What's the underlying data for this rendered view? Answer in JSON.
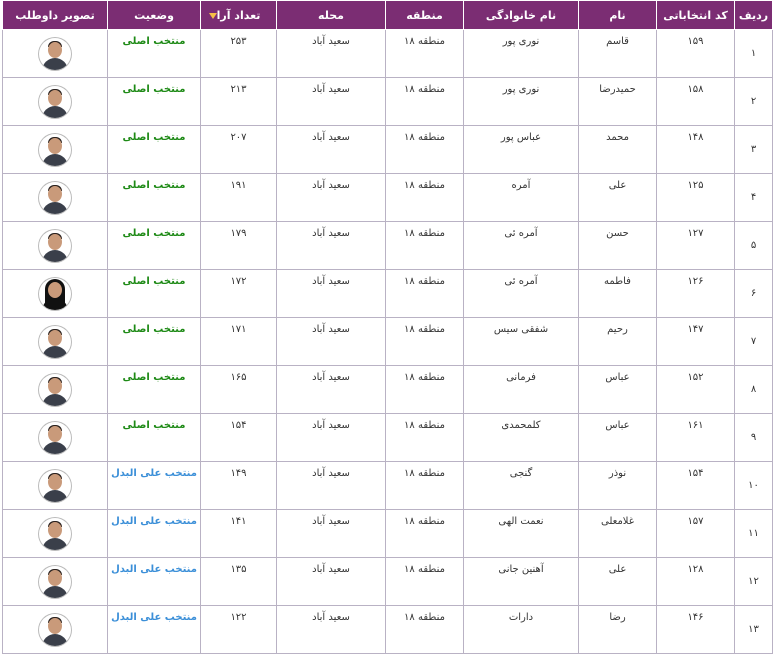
{
  "headers": {
    "row": "ردیف",
    "code": "کد انتخاباتی",
    "first_name": "نام",
    "last_name": "نام خانوادگی",
    "region": "منطقه",
    "area": "محله",
    "votes": "تعداد آرا",
    "status": "وضعیت",
    "photo": "تصویر داوطلب"
  },
  "sort_indicator_icon": "sort-desc-arrow-icon",
  "colors": {
    "header_bg": "#7b2d73",
    "status_main": "#1e8a16",
    "status_alternate": "#3b8fd8"
  },
  "rows": [
    {
      "row": "۱",
      "code": "۱۵۹",
      "first_name": "قاسم",
      "last_name": "نوری پور",
      "region": "منطقه ۱۸",
      "area": "سعید آباد",
      "votes": "۲۵۳",
      "status": "منتخب اصلی",
      "status_type": "main",
      "photo": "candidate-photo"
    },
    {
      "row": "۲",
      "code": "۱۵۸",
      "first_name": "حمیدرضا",
      "last_name": "نوری پور",
      "region": "منطقه ۱۸",
      "area": "سعید آباد",
      "votes": "۲۱۳",
      "status": "منتخب اصلی",
      "status_type": "main",
      "photo": "candidate-photo"
    },
    {
      "row": "۳",
      "code": "۱۴۸",
      "first_name": "محمد",
      "last_name": "عباس پور",
      "region": "منطقه ۱۸",
      "area": "سعید آباد",
      "votes": "۲۰۷",
      "status": "منتخب اصلی",
      "status_type": "main",
      "photo": "candidate-photo"
    },
    {
      "row": "۴",
      "code": "۱۲۵",
      "first_name": "علی",
      "last_name": "آمره",
      "region": "منطقه ۱۸",
      "area": "سعید آباد",
      "votes": "۱۹۱",
      "status": "منتخب اصلی",
      "status_type": "main",
      "photo": "candidate-photo"
    },
    {
      "row": "۵",
      "code": "۱۲۷",
      "first_name": "حسن",
      "last_name": "آمره ئی",
      "region": "منطقه ۱۸",
      "area": "سعید آباد",
      "votes": "۱۷۹",
      "status": "منتخب اصلی",
      "status_type": "main",
      "photo": "candidate-photo"
    },
    {
      "row": "۶",
      "code": "۱۲۶",
      "first_name": "فاطمه",
      "last_name": "آمره ئی",
      "region": "منطقه ۱۸",
      "area": "سعید آباد",
      "votes": "۱۷۲",
      "status": "منتخب اصلی",
      "status_type": "main",
      "photo": "candidate-photo-female"
    },
    {
      "row": "۷",
      "code": "۱۴۷",
      "first_name": "رحیم",
      "last_name": "شفقی سیس",
      "region": "منطقه ۱۸",
      "area": "سعید آباد",
      "votes": "۱۷۱",
      "status": "منتخب اصلی",
      "status_type": "main",
      "photo": "candidate-photo"
    },
    {
      "row": "۸",
      "code": "۱۵۲",
      "first_name": "عباس",
      "last_name": "فرمانی",
      "region": "منطقه ۱۸",
      "area": "سعید آباد",
      "votes": "۱۶۵",
      "status": "منتخب اصلی",
      "status_type": "main",
      "photo": "candidate-photo"
    },
    {
      "row": "۹",
      "code": "۱۶۱",
      "first_name": "عباس",
      "last_name": "کلمحمدی",
      "region": "منطقه ۱۸",
      "area": "سعید آباد",
      "votes": "۱۵۴",
      "status": "منتخب اصلی",
      "status_type": "main",
      "photo": "candidate-photo"
    },
    {
      "row": "۱۰",
      "code": "۱۵۴",
      "first_name": "نوذر",
      "last_name": "گنجی",
      "region": "منطقه ۱۸",
      "area": "سعید آباد",
      "votes": "۱۴۹",
      "status": "منتخب علی البدل",
      "status_type": "alt",
      "photo": "candidate-photo"
    },
    {
      "row": "۱۱",
      "code": "۱۵۷",
      "first_name": "غلامعلی",
      "last_name": "نعمت الهی",
      "region": "منطقه ۱۸",
      "area": "سعید آباد",
      "votes": "۱۴۱",
      "status": "منتخب علی البدل",
      "status_type": "alt",
      "photo": "candidate-photo"
    },
    {
      "row": "۱۲",
      "code": "۱۲۸",
      "first_name": "علی",
      "last_name": "آهنین جانی",
      "region": "منطقه ۱۸",
      "area": "سعید آباد",
      "votes": "۱۳۵",
      "status": "منتخب علی البدل",
      "status_type": "alt",
      "photo": "candidate-photo"
    },
    {
      "row": "۱۳",
      "code": "۱۴۶",
      "first_name": "رضا",
      "last_name": "دارات",
      "region": "منطقه ۱۸",
      "area": "سعید آباد",
      "votes": "۱۲۲",
      "status": "منتخب علی البدل",
      "status_type": "alt",
      "photo": "candidate-photo"
    }
  ]
}
